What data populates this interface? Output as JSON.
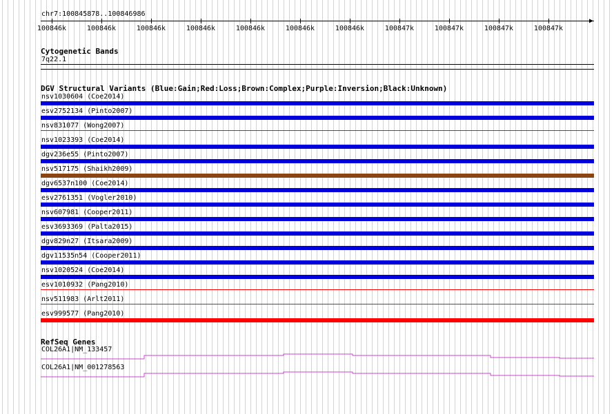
{
  "ruler": {
    "location": "chr7:100845878..100846986",
    "ticks": [
      "100846k",
      "100846k",
      "100846k",
      "100846k",
      "100846k",
      "100846k",
      "100846k",
      "100847k",
      "100847k",
      "100847k",
      "100847k"
    ]
  },
  "cytoband": {
    "title": "Cytogenetic Bands",
    "band": "7q22.1"
  },
  "dgv": {
    "title": "DGV Structural Variants (Blue:Gain;Red:Loss;Brown:Complex;Purple:Inversion;Black:Unknown)",
    "colors": {
      "gain": "#0000dd",
      "loss": "#ff0000",
      "complex": "#8b4513",
      "inversion": "#800080",
      "unknown": "#000000"
    },
    "variants": [
      {
        "label": "nsv1030604 (Coe2014)",
        "type": "gain"
      },
      {
        "label": "esv2752134 (Pinto2007)",
        "type": "gain"
      },
      {
        "label": "nsv831077 (Wong2007)",
        "type": "loss",
        "thin": true
      },
      {
        "label": "nsv1023393 (Coe2014)",
        "type": "gain"
      },
      {
        "label": "dgv236e55 (Pinto2007)",
        "type": "gain"
      },
      {
        "label": "nsv517175 (Shaikh2009)",
        "type": "complex"
      },
      {
        "label": "dgv6537n100 (Coe2014)",
        "type": "gain"
      },
      {
        "label": "esv2761351 (Vogler2010)",
        "type": "gain"
      },
      {
        "label": "nsv607981 (Cooper2011)",
        "type": "gain"
      },
      {
        "label": "esv3693369 (Palta2015)",
        "type": "gain"
      },
      {
        "label": "dgv829n27 (Itsara2009)",
        "type": "gain"
      },
      {
        "label": "dgv11535n54 (Cooper2011)",
        "type": "gain"
      },
      {
        "label": "nsv1020524 (Coe2014)",
        "type": "gain"
      },
      {
        "label": "esv1010932 (Pang2010)",
        "type": "loss",
        "thin": true
      },
      {
        "label": "nsv511983 (Arlt2011)",
        "type": "loss",
        "thin": true
      },
      {
        "label": "esv999577 (Pang2010)",
        "type": "loss"
      }
    ]
  },
  "refseq": {
    "title": "RefSeq Genes",
    "color": "#cc44cc",
    "genes": [
      {
        "label": "COL26A1|NM_133457"
      },
      {
        "label": "COL26A1|NM_001278563"
      }
    ]
  }
}
